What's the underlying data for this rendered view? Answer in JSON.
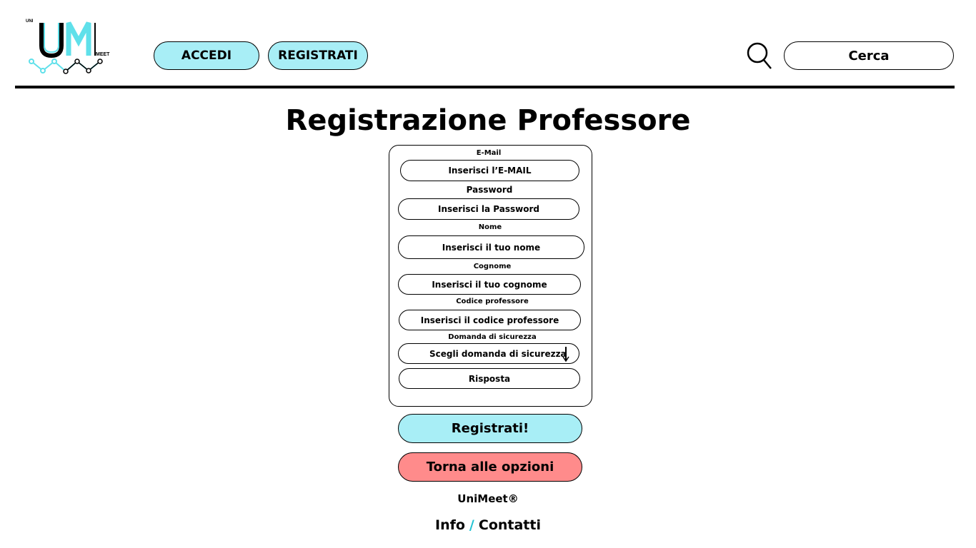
{
  "header": {
    "logo": {
      "top_text": "UNI",
      "letters": "UM",
      "bottom_text": "MEET"
    },
    "nav": {
      "login_label": "ACCEDI",
      "register_label": "REGISTRATI"
    },
    "search": {
      "placeholder": "Cerca"
    }
  },
  "page": {
    "title": "Registrazione Professore"
  },
  "form": {
    "email": {
      "label": "E-Mail",
      "placeholder": "Inserisci l’E-MAIL"
    },
    "password": {
      "label": "Password",
      "placeholder": "Inserisci la Password"
    },
    "first_name": {
      "label": "Nome",
      "placeholder": "Inserisci il tuo nome"
    },
    "last_name": {
      "label": "Cognome",
      "placeholder": "Inserisci il tuo cognome"
    },
    "professor_code": {
      "label": "Codice professore",
      "placeholder": "Inserisci il codice professore"
    },
    "security_question": {
      "label": "Domanda di sicurezza",
      "selected": "Scegli domanda di sicurezza"
    },
    "answer": {
      "placeholder": "Risposta"
    }
  },
  "actions": {
    "submit_label": "Registrati!",
    "back_label": "Torna alle opzioni"
  },
  "footer": {
    "brand": "UniMeet®",
    "info_label": "Info",
    "separator": "/",
    "contact_label": "Contatti"
  },
  "colors": {
    "accent": "#a8eef6",
    "danger": "#ff8b8b",
    "logo_cyan": "#5fe0ea",
    "separator": "#22c3d3"
  }
}
